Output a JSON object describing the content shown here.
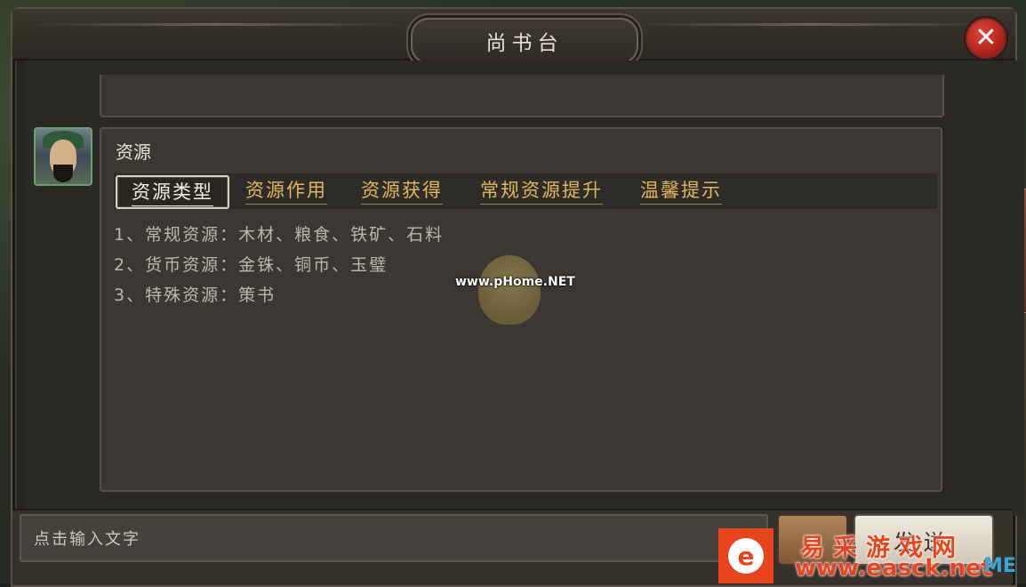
{
  "window": {
    "title": "尚书台",
    "close_icon": "close-icon"
  },
  "message": {
    "title": "资源",
    "tabs": [
      {
        "label": "资源类型",
        "active": true
      },
      {
        "label": "资源作用",
        "active": false
      },
      {
        "label": "资源获得",
        "active": false
      },
      {
        "label": "常规资源提升",
        "active": false
      },
      {
        "label": "温馨提示",
        "active": false
      }
    ],
    "lines": [
      "1、常规资源：木材、粮食、铁矿、石料",
      "2、货币资源：金铢、铜币、玉璧",
      "3、特殊资源：策书"
    ]
  },
  "input": {
    "placeholder": "点击输入文字",
    "up_label": "▲",
    "send_label": "发送"
  },
  "watermarks": {
    "center": "www.pHome.NET",
    "corner_cn": "易采游戏网",
    "corner_url": "www.easck.net",
    "corner_suffix": "ME",
    "logo_glyph": "e"
  },
  "colors": {
    "tab_text": "#e2b65a",
    "close_red": "#c0281f",
    "avatar_border": "#6aa06a"
  }
}
